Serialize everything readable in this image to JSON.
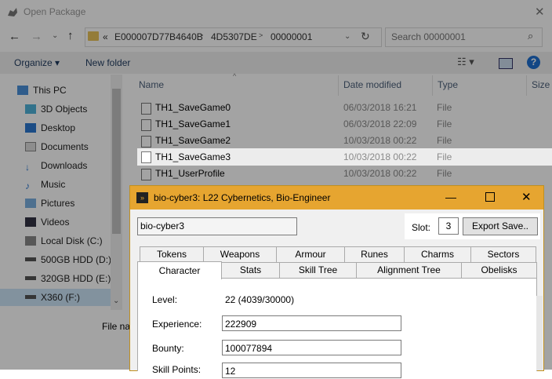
{
  "dialog": {
    "title": "Open Package",
    "breadcrumb_prefix": "«",
    "breadcrumb": [
      "E000007D77B4640B",
      "4D5307DE",
      "00000001"
    ],
    "search_placeholder": "Search 00000001",
    "organize": "Organize ▾",
    "new_folder": "New folder",
    "columns": [
      "Name",
      "Date modified",
      "Type",
      "Size"
    ],
    "file_name_label": "File na",
    "sidebar": [
      {
        "label": "This PC",
        "icon": "monitor-icon"
      },
      {
        "label": "3D Objects",
        "icon": "cube-icon"
      },
      {
        "label": "Desktop",
        "icon": "desktop-icon"
      },
      {
        "label": "Documents",
        "icon": "documents-icon"
      },
      {
        "label": "Downloads",
        "icon": "download-icon"
      },
      {
        "label": "Music",
        "icon": "music-icon"
      },
      {
        "label": "Pictures",
        "icon": "pictures-icon"
      },
      {
        "label": "Videos",
        "icon": "videos-icon"
      },
      {
        "label": "Local Disk (C:)",
        "icon": "disk-icon"
      },
      {
        "label": "500GB HDD (D:)",
        "icon": "drive-icon"
      },
      {
        "label": "320GB HDD (E:)",
        "icon": "drive-icon"
      },
      {
        "label": "X360 (F:)",
        "icon": "drive-icon"
      }
    ],
    "files": [
      {
        "name": "TH1_SaveGame0",
        "date": "06/03/2018 16:21",
        "type": "File"
      },
      {
        "name": "TH1_SaveGame1",
        "date": "06/03/2018 22:09",
        "type": "File"
      },
      {
        "name": "TH1_SaveGame2",
        "date": "10/03/2018 00:22",
        "type": "File"
      },
      {
        "name": "TH1_SaveGame3",
        "date": "10/03/2018 00:22",
        "type": "File"
      },
      {
        "name": "TH1_UserProfile",
        "date": "10/03/2018 00:22",
        "type": "File"
      }
    ]
  },
  "app": {
    "title": "bio-cyber3: L22 Cybernetics, Bio-Engineer",
    "char_name": "bio-cyber3",
    "slot_label": "Slot:",
    "slot_value": "3",
    "export_button": "Export Save..",
    "tabs_top": [
      "Tokens",
      "Weapons",
      "Armour",
      "Runes",
      "Charms",
      "Sectors"
    ],
    "tabs_bottom": [
      "Character",
      "Stats",
      "Skill Tree",
      "Alignment Tree",
      "Obelisks"
    ],
    "fields": {
      "level_label": "Level:",
      "level_value": "22 (4039/30000)",
      "experience_label": "Experience:",
      "experience_value": "222909",
      "bounty_label": "Bounty:",
      "bounty_value": "100077894",
      "skill_label": "Skill Points:",
      "skill_value": "12"
    }
  },
  "colors": {
    "app_title_bar": "#e6a530",
    "overlay": "#000000"
  }
}
